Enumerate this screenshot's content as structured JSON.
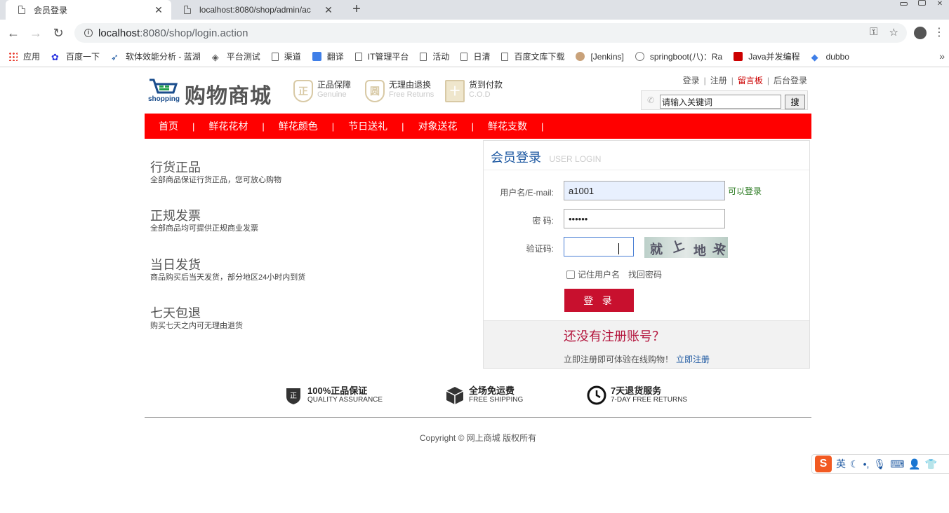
{
  "browser": {
    "tabs": [
      {
        "title": "会员登录",
        "active": true
      },
      {
        "title": "localhost:8080/shop/admin/ac",
        "active": false
      }
    ],
    "new_tab": "+",
    "url_host": "localhost",
    "url_path": ":8080/shop/login.action",
    "bookmarks": [
      "应用",
      "百度一下",
      "软体效能分析 - 蓝湖",
      "平台测试",
      "渠道",
      "翻译",
      "IT管理平台",
      "活动",
      "日清",
      "百度文库下载",
      "[Jenkins]",
      "springboot(八)：Ra",
      "Java并发编程",
      "dubbo"
    ],
    "bookmarks_more": "»"
  },
  "site": {
    "logo_title": "购物商城",
    "logo_sub": "shopping",
    "features": [
      {
        "main": "正品保障",
        "sub": "Genuine",
        "seal": "正"
      },
      {
        "main": "无理由退换",
        "sub": "Free Returns",
        "seal": "圆"
      },
      {
        "main": "货到付款",
        "sub": "C.O.D",
        "seal": "十"
      }
    ],
    "top_links": {
      "login": "登录",
      "register": "注册",
      "board": "留言板",
      "admin": "后台登录"
    },
    "search": {
      "value": "请输入关键词",
      "button": "搜"
    },
    "nav": [
      "首页",
      "鲜花花材",
      "鲜花颜色",
      "节日送礼",
      "对象送花",
      "鲜花支数"
    ],
    "nav_sep": "|",
    "promos": [
      {
        "title": "行货正品",
        "text": "全部商品保证行货正品，您可放心购物"
      },
      {
        "title": "正规发票",
        "text": "全部商品均可提供正规商业发票"
      },
      {
        "title": "当日发货",
        "text": "商品购买后当天发货，部分地区24小时内到货"
      },
      {
        "title": "七天包退",
        "text": "购买七天之内可无理由退货"
      }
    ]
  },
  "login": {
    "title": "会员登录",
    "title_en": "USER LOGIN",
    "username_label": "用户名/E-mail:",
    "username_value": "a1001",
    "username_ok": "可以登录",
    "password_label": "密  码:",
    "password_value": "••••••",
    "captcha_label": "验证码:",
    "captcha_value": "",
    "captcha_chars": [
      "就",
      "上",
      "地",
      "来"
    ],
    "remember_label": "记住用户名",
    "forgot_label": "找回密码",
    "submit": "登 录",
    "reg_title": "还没有注册账号？",
    "reg_text": "立即注册即可体验在线购物！",
    "reg_link": "立即注册"
  },
  "services": [
    {
      "main": "100%正品保证",
      "sub": "QUALITY ASSURANCE"
    },
    {
      "main": "全场免运费",
      "sub": "FREE SHIPPING"
    },
    {
      "main": "7天退货服务",
      "sub": "7-DAY FREE RETURNS"
    }
  ],
  "copyright": "Copyright © 网上商城 版权所有",
  "ime": {
    "logo": "S",
    "mode": "英"
  },
  "colors": {
    "nav_red": "#ff0000",
    "login_btn": "#c8102e",
    "link_blue": "#1a56a0",
    "reg_red": "#b3143c"
  }
}
